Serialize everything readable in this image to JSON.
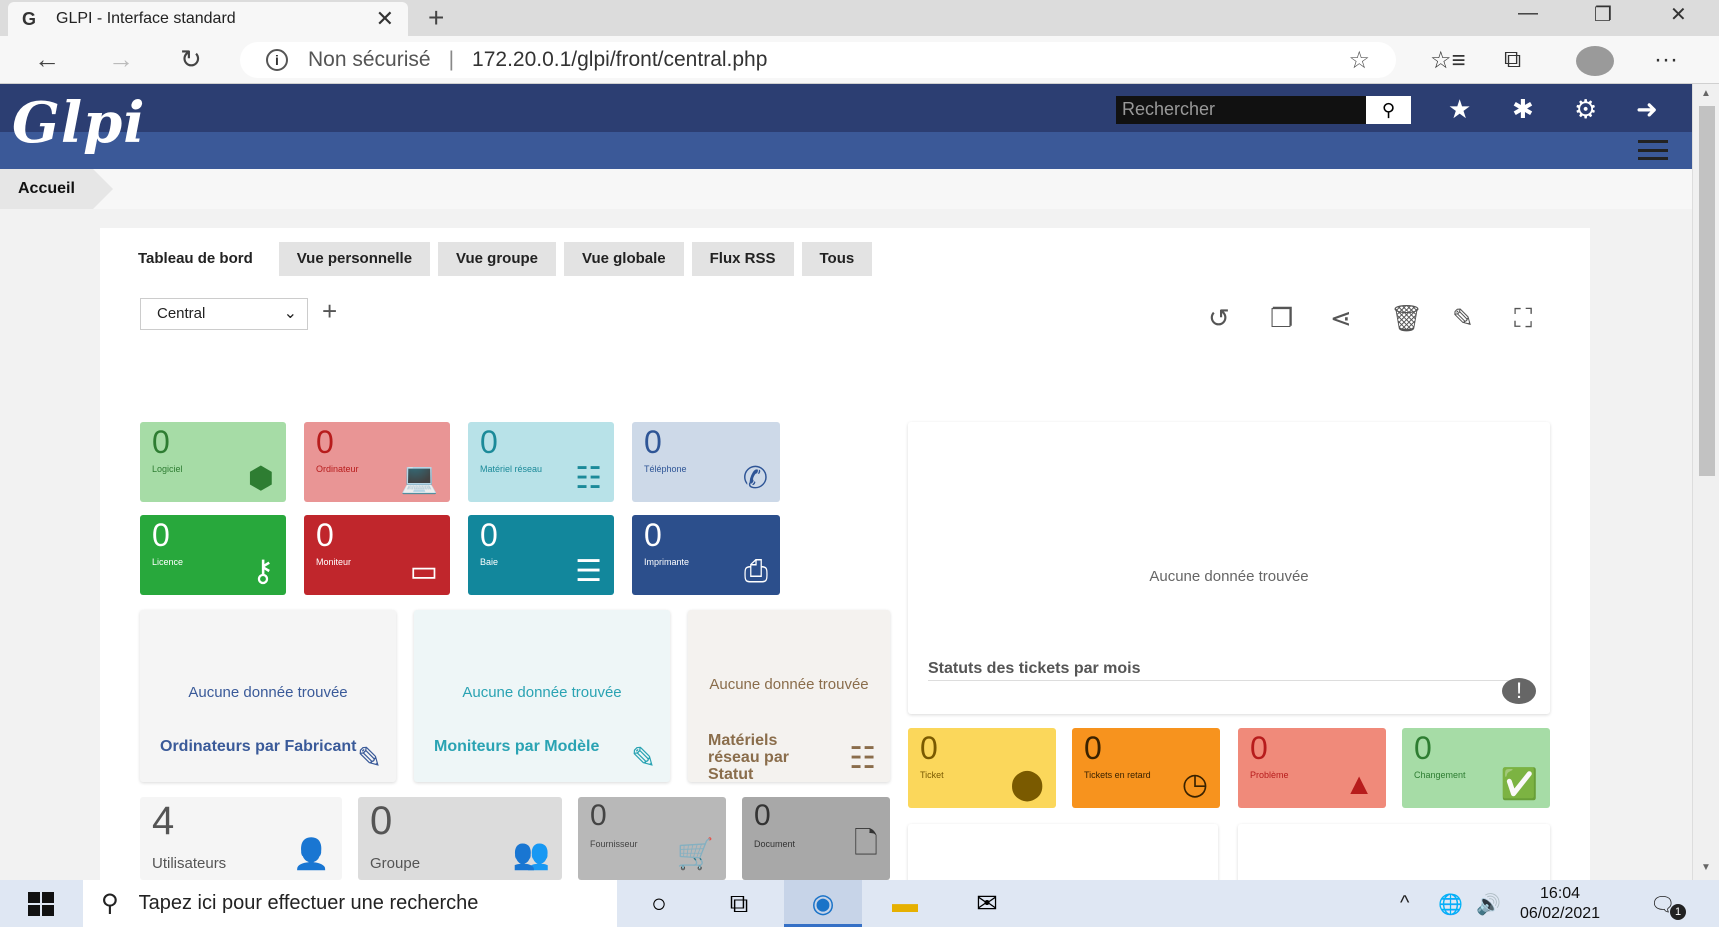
{
  "browser": {
    "tab_title": "GLPI - Interface standard",
    "tab_icon": "G",
    "security_label": "Non sécurisé",
    "url": "172.20.0.1/glpi/front/central.php"
  },
  "header": {
    "logo": "Glpi",
    "search_placeholder": "Rechercher"
  },
  "breadcrumb": "Accueil",
  "tabs": [
    "Tableau de bord",
    "Vue personnelle",
    "Vue groupe",
    "Vue globale",
    "Flux RSS",
    "Tous"
  ],
  "dashboard_select": "Central",
  "asset_tiles": [
    {
      "value": "0",
      "label": "Logiciel",
      "icon": "box-icon",
      "bg": "#a6dca6",
      "color": "#2e7d32"
    },
    {
      "value": "0",
      "label": "Ordinateur",
      "icon": "laptop-icon",
      "bg": "#e99595",
      "color": "#b71c1c"
    },
    {
      "value": "0",
      "label": "Matériel réseau",
      "icon": "network-icon",
      "bg": "#b8e2e8",
      "color": "#1b8a99"
    },
    {
      "value": "0",
      "label": "Téléphone",
      "icon": "phone-icon",
      "bg": "#cdd9e8",
      "color": "#2e5596"
    },
    {
      "value": "0",
      "label": "Licence",
      "icon": "key-icon",
      "bg": "#28a83c",
      "color": "#ffffff"
    },
    {
      "value": "0",
      "label": "Moniteur",
      "icon": "monitor-icon",
      "bg": "#c0262c",
      "color": "#ffffff"
    },
    {
      "value": "0",
      "label": "Baie",
      "icon": "rack-icon",
      "bg": "#12879c",
      "color": "#ffffff"
    },
    {
      "value": "0",
      "label": "Imprimante",
      "icon": "printer-icon",
      "bg": "#2c4f8c",
      "color": "#ffffff"
    }
  ],
  "panels": [
    {
      "nodata": "Aucune donnée trouvée",
      "title": "Ordinateurs par Fabricant",
      "icon": "edit-icon",
      "bg": "#f5f5f5",
      "color": "#3a5a99"
    },
    {
      "nodata": "Aucune donnée trouvée",
      "title": "Moniteurs par Modèle",
      "icon": "edit-icon",
      "bg": "#eef6f7",
      "color": "#2aa3b3"
    },
    {
      "nodata": "Aucune donnée trouvée",
      "title": "Matériels réseau par Statut",
      "icon": "network-icon",
      "bg": "#f4f2ef",
      "color": "#8a6d4b"
    }
  ],
  "ticket_chart": {
    "nodata": "Aucune donnée trouvée",
    "title": "Statuts des tickets par mois"
  },
  "ticket_tiles": [
    {
      "value": "0",
      "label": "Ticket",
      "icon": "alert-circle-icon",
      "bg": "#fbd75b",
      "color": "#7a5a00"
    },
    {
      "value": "0",
      "label": "Tickets en retard",
      "icon": "clock-icon",
      "bg": "#f7931e",
      "color": "#3a2200"
    },
    {
      "value": "0",
      "label": "Problème",
      "icon": "warning-icon",
      "bg": "#f08a7a",
      "color": "#b71c1c"
    },
    {
      "value": "0",
      "label": "Changement",
      "icon": "clipboard-check-icon",
      "bg": "#a6dca6",
      "color": "#2e7d32"
    }
  ],
  "bottom_tiles": [
    {
      "value": "4",
      "label": "Utilisateurs",
      "icon": "user-icon",
      "bg": "#f5f5f5",
      "color": "#555"
    },
    {
      "value": "0",
      "label": "Groupe",
      "icon": "group-icon",
      "bg": "#dcdcdc",
      "color": "#555"
    },
    {
      "value": "0",
      "label": "Fournisseur",
      "icon": "cart-icon",
      "bg": "#b8b8b8",
      "color": "#444"
    },
    {
      "value": "0",
      "label": "Document",
      "icon": "file-icon",
      "bg": "#a8a8a8",
      "color": "#333"
    }
  ],
  "taskbar": {
    "search_text": "Tapez ici pour effectuer une recherche",
    "time": "16:04",
    "date": "06/02/2021",
    "notif_count": "1"
  }
}
